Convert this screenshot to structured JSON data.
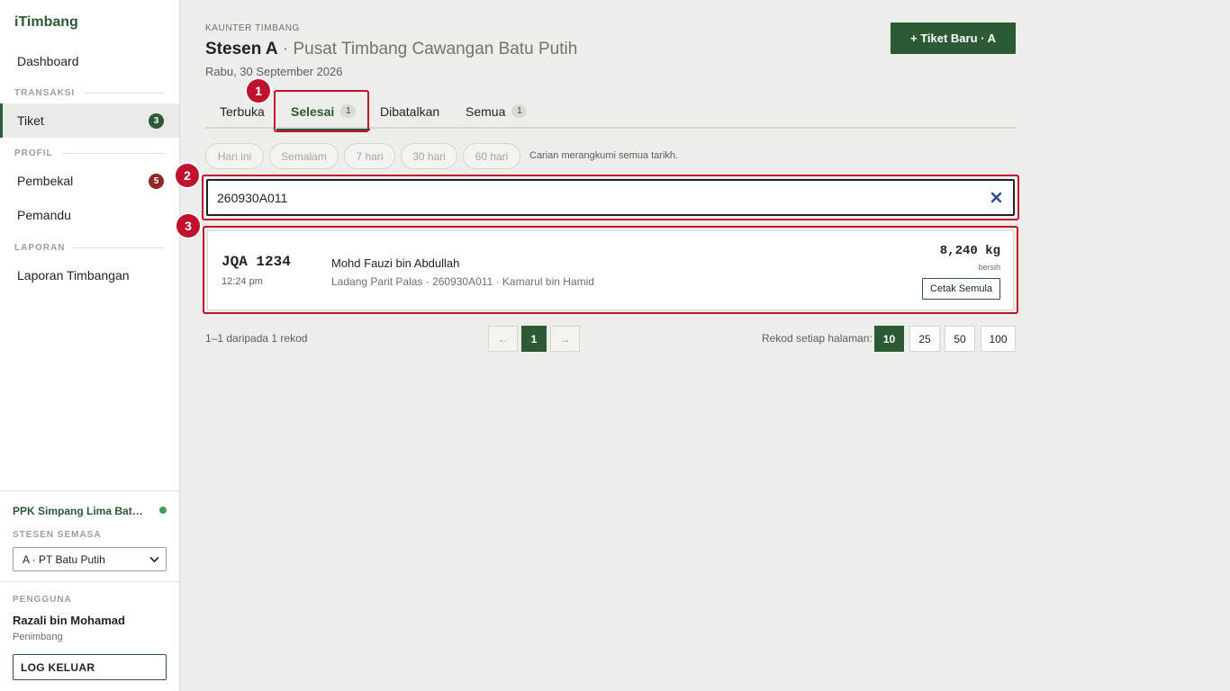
{
  "app": {
    "brand": "iTimbang"
  },
  "sidebar": {
    "dashboard": "Dashboard",
    "sections": {
      "transaksi": "TRANSAKSI",
      "profil": "PROFIL",
      "laporan": "LAPORAN"
    },
    "items": [
      {
        "label": "Tiket",
        "badge": "3",
        "active": true
      },
      {
        "label": "Pembekal",
        "badge": "5"
      },
      {
        "label": "Pemandu"
      },
      {
        "label": "Laporan Timbangan"
      }
    ],
    "org": "PPK Simpang Lima Batu Putih",
    "station_label": "STESEN SEMASA",
    "station_value": "A · PT Batu Putih",
    "user_label": "PENGGUNA",
    "user_name": "Razali bin Mohamad",
    "user_role": "Penimbang",
    "logout": "LOG KELUAR"
  },
  "header": {
    "kicker": "KAUNTER TIMBANG",
    "station": "Stesen A",
    "separator": " · ",
    "subtitle": "Pusat Timbang Cawangan Batu Putih",
    "date": "Rabu, 30 September 2026",
    "new_ticket": "+ Tiket Baru · A"
  },
  "tabs": [
    {
      "label": "Terbuka"
    },
    {
      "label": "Selesai",
      "count": "1",
      "active": true
    },
    {
      "label": "Dibatalkan"
    },
    {
      "label": "Semua",
      "count": "1"
    }
  ],
  "filters": {
    "chips": [
      "Hari ini",
      "Semalam",
      "7 hari",
      "30 hari",
      "60 hari"
    ],
    "note": "Carian merangkumi semua tarikh."
  },
  "search": {
    "value": "260930A011"
  },
  "results": [
    {
      "plate": "JQA 1234",
      "time": "12:24 pm",
      "driver": "Mohd Fauzi bin Abdullah",
      "meta": "Ladang Parit Palas · 260930A011 · Kamarul bin Hamid",
      "weight": "8,240 kg",
      "weight_label": "bersih",
      "reprint": "Cetak Semula"
    }
  ],
  "annotations": [
    "1",
    "2",
    "3"
  ],
  "pagination": {
    "info": "1–1 daripada 1 rekod",
    "prev": "←",
    "current": "1",
    "next": "→",
    "per_page_label": "Rekod setiap halaman:",
    "per_page_options": [
      "10",
      "25",
      "50",
      "100"
    ],
    "per_page_selected": "10"
  },
  "colors": {
    "accent": "#2d5a36",
    "danger": "#8e2a26",
    "annotation": "#c0122f",
    "status_online": "#3e9d55"
  }
}
